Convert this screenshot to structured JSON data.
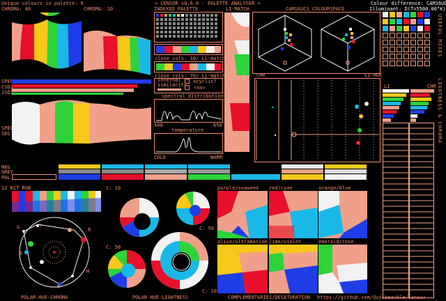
{
  "header": {
    "unique_colours": "Unique colours in palette: 8",
    "title": "= CENSOR v0.6.0 - PALETTE ANALYSER =",
    "colour_difference": "Colour difference: CAM16UCS",
    "illuminant": "Illuminant: D(T=5500.00°K)"
  },
  "labels": {
    "chroma40": "CHROMA: 40",
    "chroma10": "CHROMA: 10",
    "indexed_palette": "INDEXED PALETTE",
    "li_match": "LI-MATCH",
    "cam16_space": "CAM16UCS COLOURSPACE",
    "spec": "SPEC",
    "csd2": "CSD2",
    "jsd2": "JSD2",
    "spec2": "SPEC",
    "sds": "SDS",
    "close_cols_10": "close cols: 10/ Li-match",
    "close_cols_70": "close cols: 70/ Li-match",
    "internal_similarity": "internal similarity",
    "acyclic": "acyclic?",
    "na": "<na>",
    "spectral_distribution": "spectral distribution",
    "wl_min": "400",
    "wl_max": "650",
    "temperature": "temperature",
    "cold": "COLD",
    "warm": "WARM",
    "chr_left": "CHR",
    "li_hue": "LI-HUE",
    "li": "LI",
    "chr_right": "CHR",
    "neu": "NEU",
    "grey": "GREY",
    "pal": "PAL",
    "bit12": "12 BIT RGB",
    "c10a": "C: 10",
    "c50a": "C: 50",
    "c50b": "C: 50",
    "c10b": "C: 10",
    "purple_seaweed": "purple/seaweed",
    "red_cyan": "red/cyan",
    "orange_blue": "orange/blue",
    "olive_ultramarine": "olive/ultramarine",
    "lime_violet": "lime/violet",
    "emerald_rose": "emerald/rose",
    "polar_hue_chroma": "POLAR HUE-CHROMA",
    "polar_hue_lightness": "POLAR HUE-LIGHTNESS",
    "complementaries": "COMPLEMENTARIES/DESATURATION",
    "url": "https://github.com/Quickmarble/censor",
    "useful_mixes": "USEFUL MIXES",
    "lightness_chroma": "LIGHTNESS & CHROMA",
    "wheel_g": "G",
    "wheel_y": "Y",
    "wheel_r": "R",
    "wheel_c": "C",
    "wheel_m": "M",
    "wheel_b": "B",
    "wheel_e": "E"
  },
  "palette": [
    {
      "name": "black",
      "hex": "#000000"
    },
    {
      "name": "blue",
      "hex": "#1f3de6"
    },
    {
      "name": "red",
      "hex": "#e8102a"
    },
    {
      "name": "salmon",
      "hex": "#f0a08a"
    },
    {
      "name": "green",
      "hex": "#2ed33a"
    },
    {
      "name": "cyan",
      "hex": "#1ab8e6"
    },
    {
      "name": "yellow",
      "hex": "#f5c81a"
    },
    {
      "name": "white",
      "hex": "#f2f2f2"
    }
  ],
  "accent": "#f08c6c"
}
